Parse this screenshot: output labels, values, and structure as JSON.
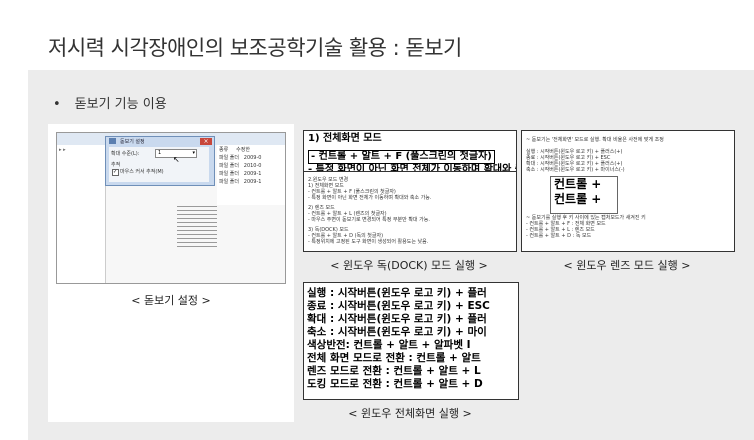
{
  "title": "저시력 시각장애인의 보조공학기술 활용 : 돋보기",
  "bullet": "돋보기 기능 이용",
  "captions": {
    "settings": "< 돋보기 설정 >",
    "dock": "< 윈도우 독(DOCK) 모드 실행 >",
    "lens": "< 윈도우 렌즈 모드 실행 >",
    "fullscreen": "< 윈도우 전체화면 실행 >"
  },
  "dialog": {
    "title": "돋보기 설정",
    "zoom_label": "확대 수준(L):",
    "zoom_value": "1",
    "track_label": "추적",
    "follow_mouse": "마우스 커서 추적(M)"
  },
  "dock_shot": {
    "header_lines": [
      "1) 전체화면 모드",
      "- 컨트롤 + 알트 + F (풀스크린의 첫글자)",
      "- 특정 화면이 아닌 화면 전체가 이동하며 확대와 축"
    ],
    "body_lines": [
      "2.윈도우 모드 변경",
      "1) 전체화면 모드",
      "- 컨트롤 + 알트 + F (풀스크린의 첫글자)",
      "- 특정 화면이 아닌 화면 전체가 이동하며 확대와 축소 가능.",
      "2) 렌즈 모드",
      "- 컨트롤 + 알트 + L (렌즈의 첫글자)",
      "- 마우스 주변이 돋보기로 변경되어 특정 부분만 확대 가능.",
      "3) 독(DOCK) 모드",
      "- 컨트롤 + 알트 + D (독의 첫글자)",
      "- 특정위치에 고정된 도구 화면이 생성되어 활용도는 낮음."
    ]
  },
  "lens_shot": {
    "top_lines": [
      "~ 돋보기는 '전체화면' 모드로 실행. 확대 비율은 사전에 맞게 조정",
      "실행 : 시작버튼(윈도우 로고 키) + 플러스(+)",
      "종료 : 시작버튼(윈도우 로고 키) + ESC",
      "확대 : 시작버튼(윈도우 로고 키) + 플러스(+)",
      "축소 : 시작버튼(윈도우 로고 키) + 마이너스(-)"
    ],
    "big_lines": [
      "컨트롤 +",
      "컨트롤 +"
    ],
    "bottom_lines": [
      "~ 돋보기를 실행 후 키 사이에 있는 캡처모드가 새겨진 키",
      "- 컨트롤 + 알트 + F : 전체 화면 모드",
      "- 컨트롤 + 알트 + L : 렌즈 모드",
      "- 컨트롤 + 알트 + D : 독 모드"
    ]
  },
  "full_shot": {
    "lines": [
      "실행 : 시작버튼(윈도우 로고 키) + 플러",
      "종료 : 시작버튼(윈도우 로고 키) + ESC",
      "확대 : 시작버튼(윈도우 로고 키) + 플러",
      "축소 : 시작버튼(윈도우 로고 키) + 마이",
      "색상반전: 컨트롤 + 알트 + 알파벳 I",
      "전체 화면 모드로 전환 : 컨트롤 + 알트",
      "렌즈 모드로 전환 : 컨트롤 + 알트 + L",
      "도킹 모드로 전환 : 컨트롤 + 알트 + D"
    ]
  }
}
